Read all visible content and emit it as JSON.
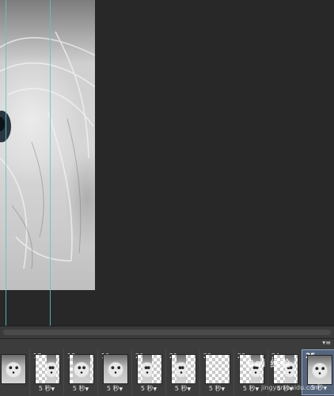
{
  "canvas": {
    "guides": 2
  },
  "timeline": {
    "panel_menu_icon": "panel-menu-icon",
    "frames": [
      {
        "number": "",
        "delay": "",
        "content": "dog-full"
      },
      {
        "number": "17",
        "delay": "5 秒",
        "content": "dog-strip-right"
      },
      {
        "number": "18",
        "delay": "5 秒",
        "content": "dog-wide"
      },
      {
        "number": "19",
        "delay": "5 秒",
        "content": "dog-full"
      },
      {
        "number": "20",
        "delay": "5 秒",
        "content": "dog-strip-left"
      },
      {
        "number": "21",
        "delay": "5 秒",
        "content": "dog-strip-left"
      },
      {
        "number": "22",
        "delay": "5 秒",
        "content": "transparent"
      },
      {
        "number": "23",
        "delay": "5 秒",
        "content": "dog-strip-right"
      },
      {
        "number": "24",
        "delay": "5 秒",
        "content": "dog-strip-right"
      },
      {
        "number": "25",
        "delay": "5 秒",
        "content": "dog-full",
        "selected": true
      }
    ]
  },
  "watermark": {
    "text": "Bai 经验",
    "sub": "jingyan.baidu.com"
  }
}
